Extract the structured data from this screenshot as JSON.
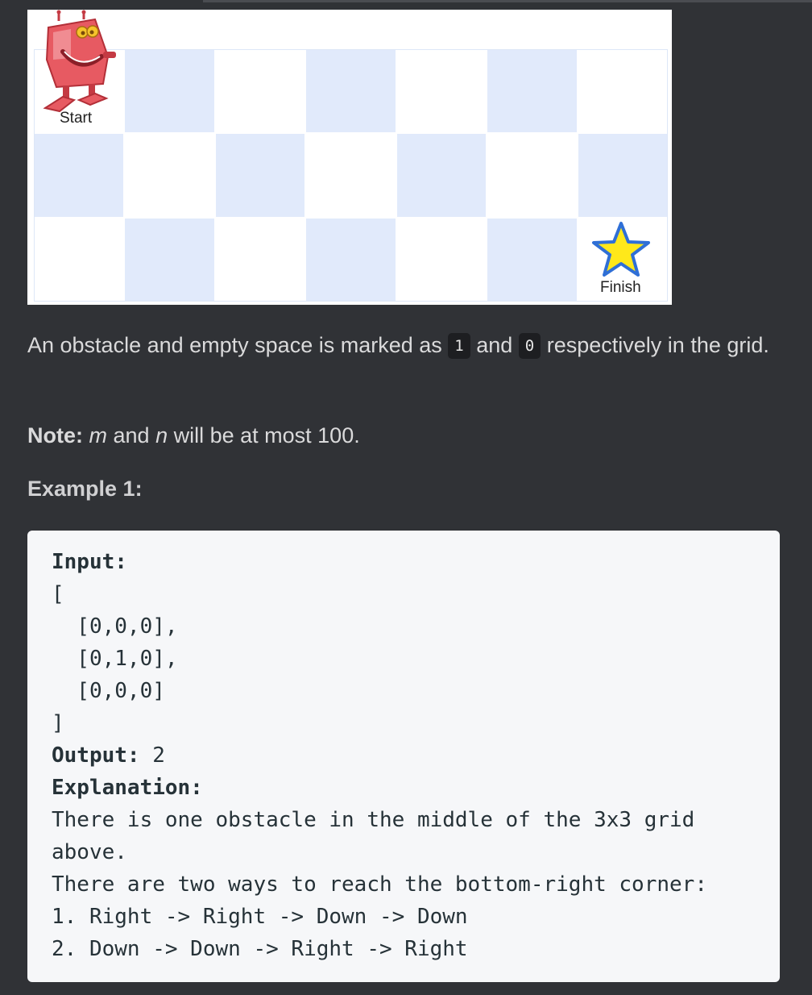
{
  "illustration": {
    "start_label": "Start",
    "finish_label": "Finish",
    "grid": {
      "rows": 3,
      "cols": 7,
      "colors": [
        "#ffffff",
        "#e1eafb"
      ]
    },
    "robot_icon": "robot-icon",
    "star_icon": "star-icon"
  },
  "text": {
    "p1_before": "An obstacle and empty space is marked as ",
    "p1_code1": "1",
    "p1_mid": " and ",
    "p1_code0": "0",
    "p1_after": " respectively in the grid.",
    "note_label": "Note:",
    "note_m": "m",
    "note_and": " and ",
    "note_n": "n",
    "note_rest": " will be at most 100."
  },
  "example": {
    "title": "Example 1:",
    "input_label": "Input:",
    "input_lines": [
      "[",
      "  [0,0,0],",
      "  [0,1,0],",
      "  [0,0,0]",
      "]"
    ],
    "output_label": "Output:",
    "output_value": " 2",
    "explanation_label": "Explanation:",
    "explanation_lines": [
      "There is one obstacle in the middle of the 3x3 grid",
      "above.",
      "There are two ways to reach the bottom-right corner:",
      "1. Right -> Right -> Down -> Down",
      "2. Down -> Down -> Right -> Right"
    ]
  },
  "colors": {
    "background": "#303236",
    "code_background": "#f6f7f9",
    "inline_code_background": "#1d1e21",
    "star_fill": "#ffe81a",
    "star_stroke": "#2f6fd6",
    "robot_red": "#e0464f"
  }
}
